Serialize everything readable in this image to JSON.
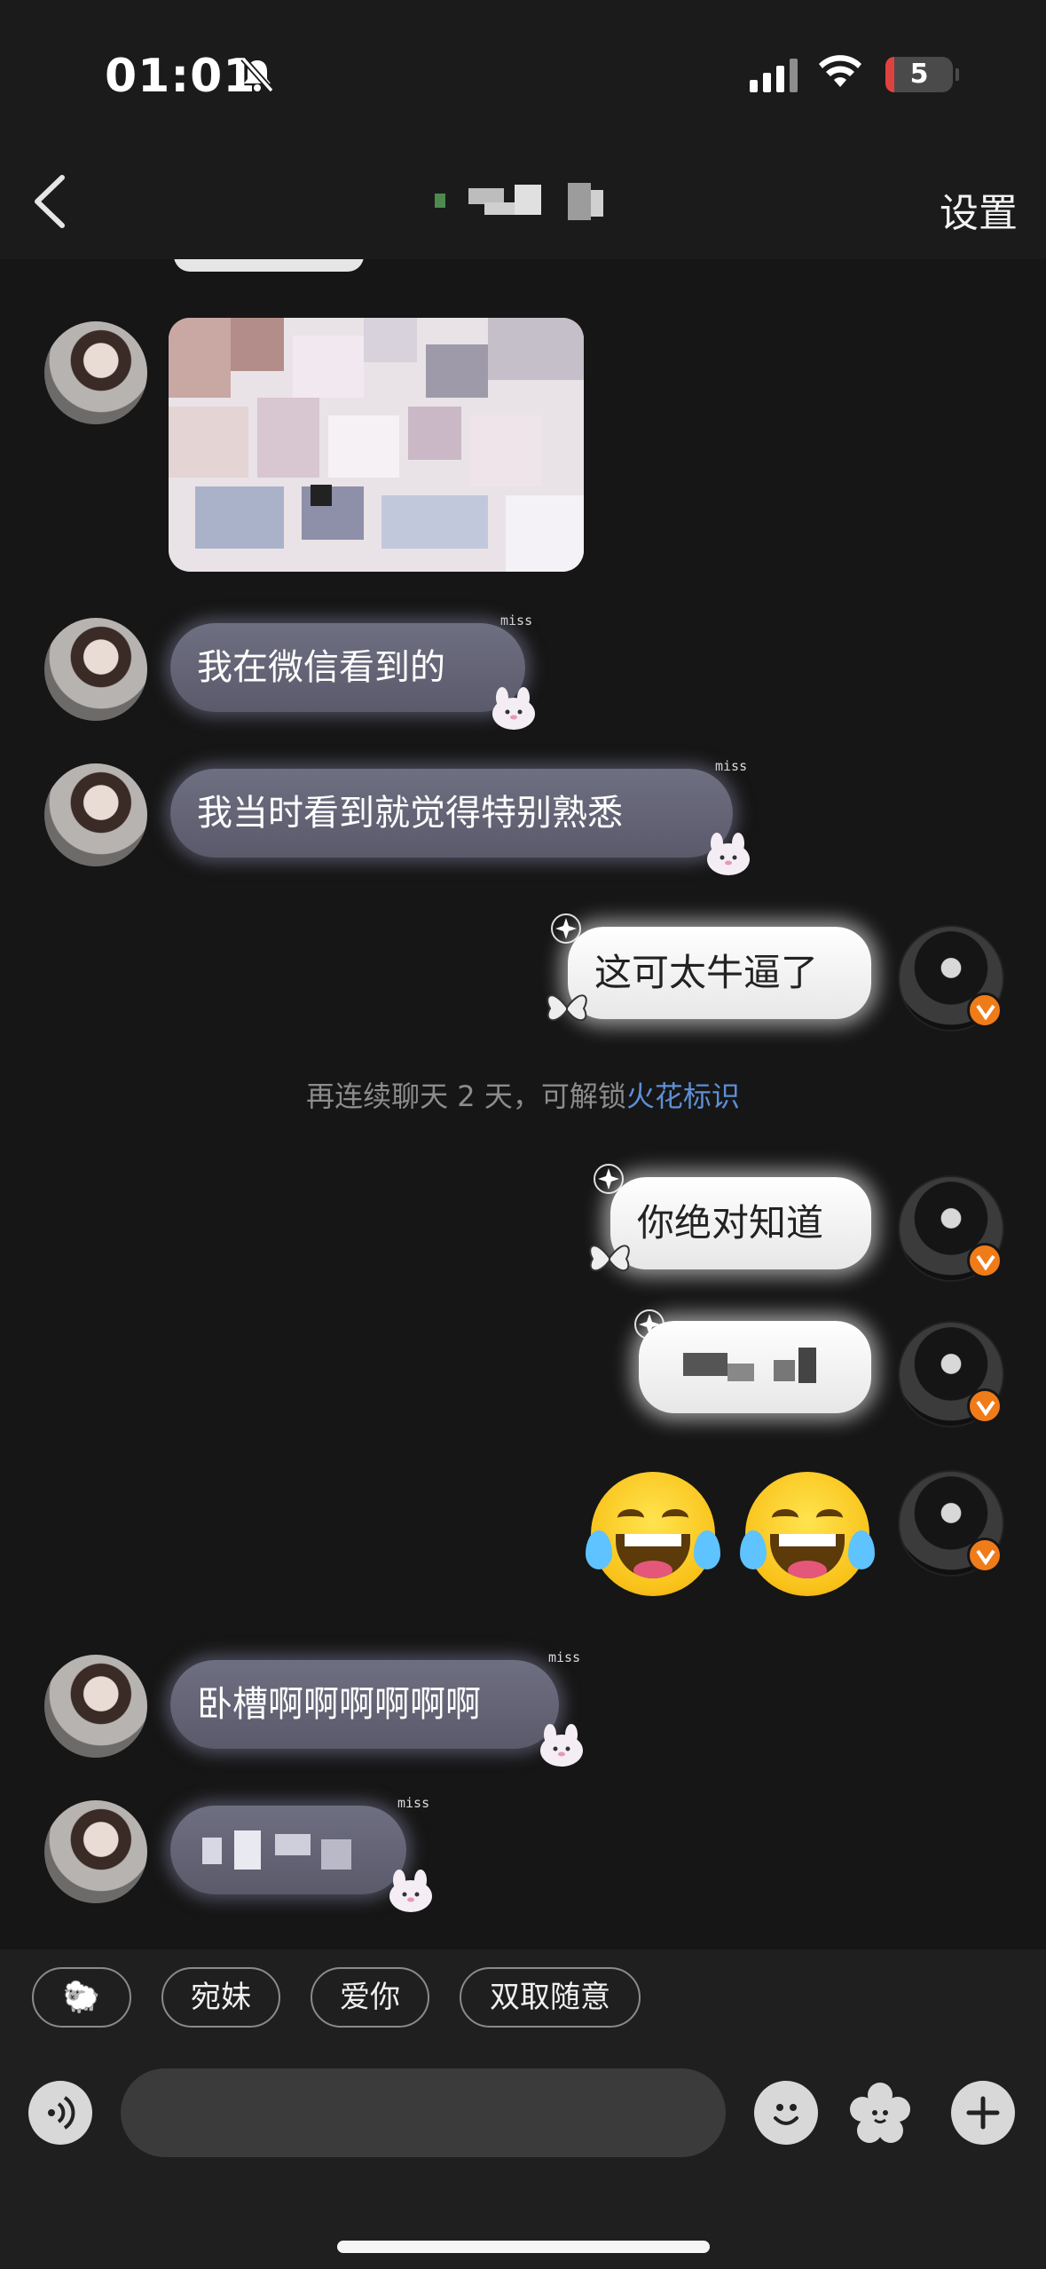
{
  "status_bar": {
    "time": "01:01",
    "battery_level": "5",
    "battery_color": "#e0433f"
  },
  "nav": {
    "settings_label": "设置"
  },
  "messages": [
    {
      "side": "in",
      "type": "image"
    },
    {
      "side": "in",
      "type": "text",
      "text": "我在微信看到的",
      "sticker": "miss"
    },
    {
      "side": "in",
      "type": "text",
      "text": "我当时看到就觉得特别熟悉",
      "sticker": "miss"
    },
    {
      "side": "out",
      "type": "text",
      "text": "这可太牛逼了"
    },
    {
      "side": "out",
      "type": "text",
      "text": "你绝对知道"
    },
    {
      "side": "out",
      "type": "text",
      "text": ""
    },
    {
      "side": "out",
      "type": "emoji",
      "emoji": "face-with-tears-of-joy-icon x2"
    },
    {
      "side": "in",
      "type": "text",
      "text": "卧槽啊啊啊啊啊啊",
      "sticker": "miss"
    },
    {
      "side": "in",
      "type": "text",
      "text": "",
      "sticker": "miss"
    }
  ],
  "system_tip": {
    "text": "再连续聊天 2 天，可解锁",
    "link": "火花标识"
  },
  "quick_replies": [
    "🐑",
    "宛妹",
    "爱你",
    "双取随意"
  ],
  "input": {
    "placeholder": ""
  },
  "colors": {
    "background": "#161616",
    "incoming_bubble": "#62627a",
    "outgoing_bubble": "#ffffff",
    "link": "#5d8fd6",
    "verified_badge": "#f07b19"
  }
}
